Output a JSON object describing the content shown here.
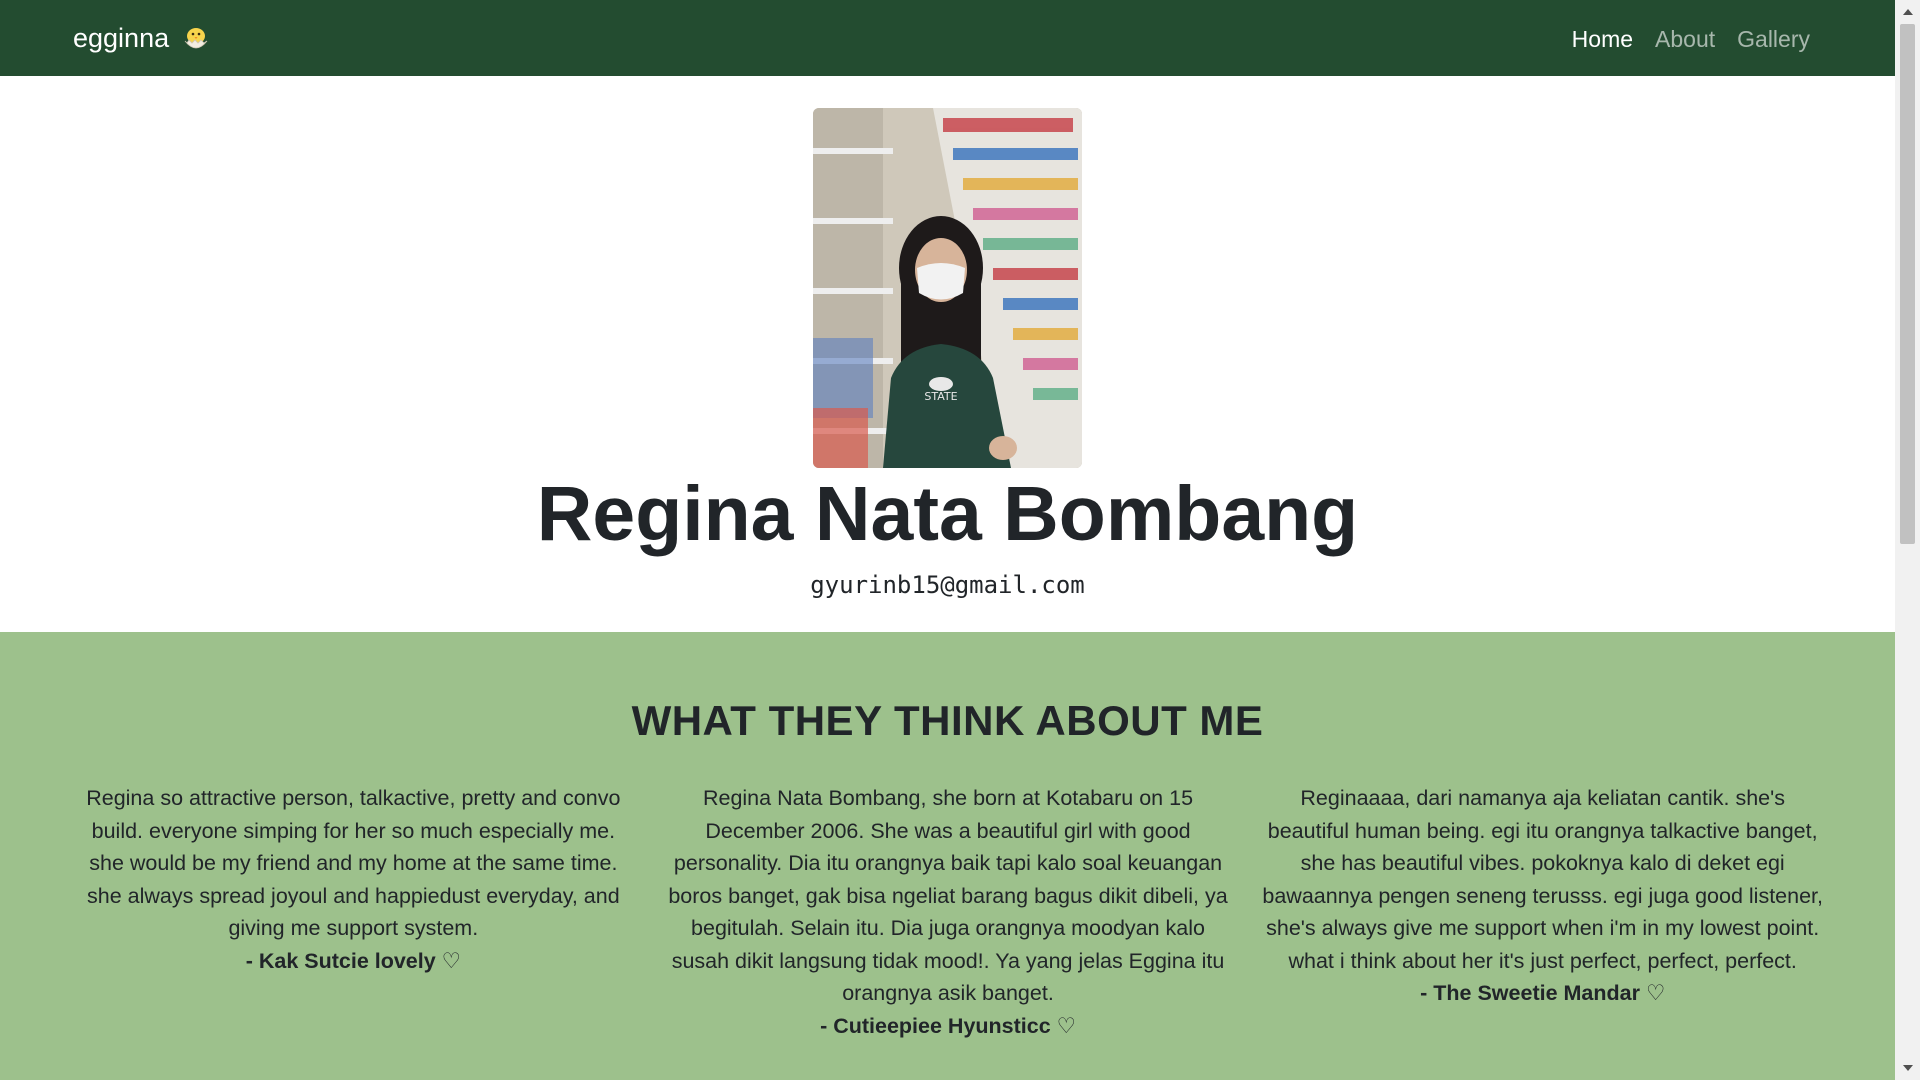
{
  "navbar": {
    "brand": "egginna",
    "brand_icon": "chick-hatching-icon",
    "links": [
      {
        "label": "Home",
        "active": true
      },
      {
        "label": "About",
        "active": false
      },
      {
        "label": "Gallery",
        "active": false
      }
    ]
  },
  "profile": {
    "name": "Regina Nata Bombang",
    "email": "gyurinb15@gmail.com"
  },
  "testimonials": {
    "title": "WHAT THEY THINK ABOUT ME",
    "items": [
      {
        "text": "Regina so attractive person, talkactive, pretty and convo build. everyone simping for her so much especially me. she would be my friend and my home at the same time. she always spread joyoul and happiedust everyday, and giving me support system.",
        "author": "- Kak Sutcie lovely ♡"
      },
      {
        "text": "Regina Nata Bombang, she born at Kotabaru on 15 December 2006. She was a beautiful girl with good personality. Dia itu orangnya baik tapi kalo soal keuangan boros banget, gak bisa ngeliat barang bagus dikit dibeli, ya begitulah. Selain itu. Dia juga orangnya moodyan kalo susah dikit langsung tidak mood!. Ya yang jelas Eggina itu orangnya asik banget.",
        "author": "- Cutieepiee Hyunsticc ♡"
      },
      {
        "text": "Reginaaaa, dari namanya aja keliatan cantik. she's beautiful human being. egi itu orangnya talkactive banget, she has beautiful vibes. pokoknya kalo di deket egi bawaannya pengen seneng terusss. egi juga good listener, she's always give me support when i'm in my lowest point. what i think about her it's just perfect, perfect, perfect.",
        "author": "- The Sweetie Mandar ♡"
      }
    ]
  },
  "colors": {
    "navbar_bg": "#234c30",
    "testimonials_bg": "#9dc18c",
    "text": "#212529"
  }
}
